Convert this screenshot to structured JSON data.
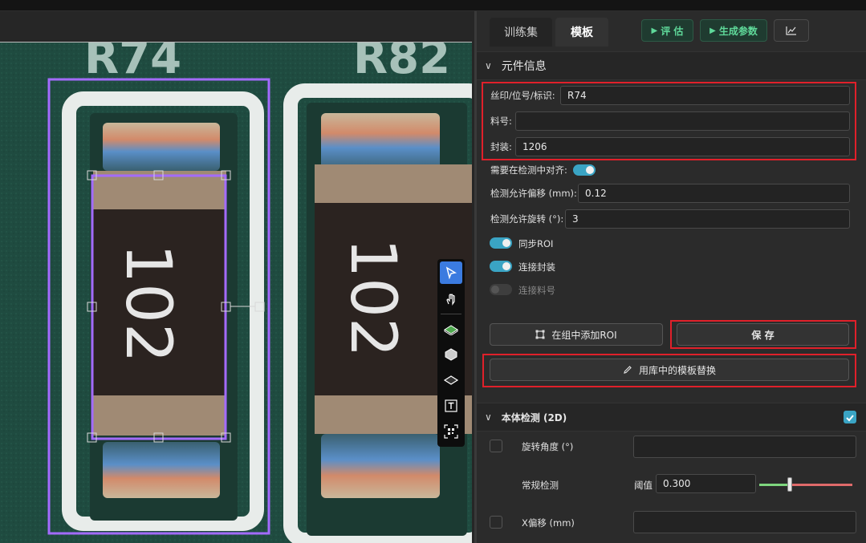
{
  "tabs": {
    "train": "训练集",
    "template": "模板"
  },
  "actions": {
    "evaluate": "评 估",
    "generate": "生成参数"
  },
  "component_info": {
    "title": "元件信息",
    "silk_label": "丝印/位号/标识:",
    "silk_value": "R74",
    "part_label": "料号:",
    "part_value": "",
    "package_label": "封装:",
    "package_value": "1206",
    "align_label": "需要在检测中对齐:",
    "offset_label": "检测允许偏移 (mm):",
    "offset_value": "0.12",
    "rotate_label": "检测允许旋转 (°):",
    "rotate_value": "3",
    "sync_roi": "同步ROI",
    "link_package": "连接封装",
    "link_part": "连接料号",
    "add_roi": "在组中添加ROI",
    "save": "保 存",
    "replace_template": "用库中的模板替换"
  },
  "body_detect": {
    "title": "本体检测 (2D)",
    "rotate_angle": "旋转角度 (°)",
    "regular": "常规检测",
    "threshold_label": "阈值",
    "threshold_value": "0.300",
    "x_offset": "X偏移 (mm)"
  },
  "canvas": {
    "silk_left": "R74",
    "silk_right": "R82",
    "marking": "102",
    "board_color": "#1e4a3f",
    "roi_color": "#a36bff"
  },
  "icons": [
    "pointer-icon",
    "hand-icon",
    "chip-green-icon",
    "chip-3d-icon",
    "chip-flat-icon",
    "text-icon",
    "qr-icon",
    "chart-icon",
    "play-icon",
    "pencil-icon",
    "roi-icon",
    "chevron-down-icon",
    "check-icon"
  ],
  "colors": {
    "accent": "#3aa4c4",
    "green": "#5fd99a",
    "highlight": "#e0202a",
    "slider_green": "#7ed67e",
    "slider_red": "#e06a6a"
  }
}
